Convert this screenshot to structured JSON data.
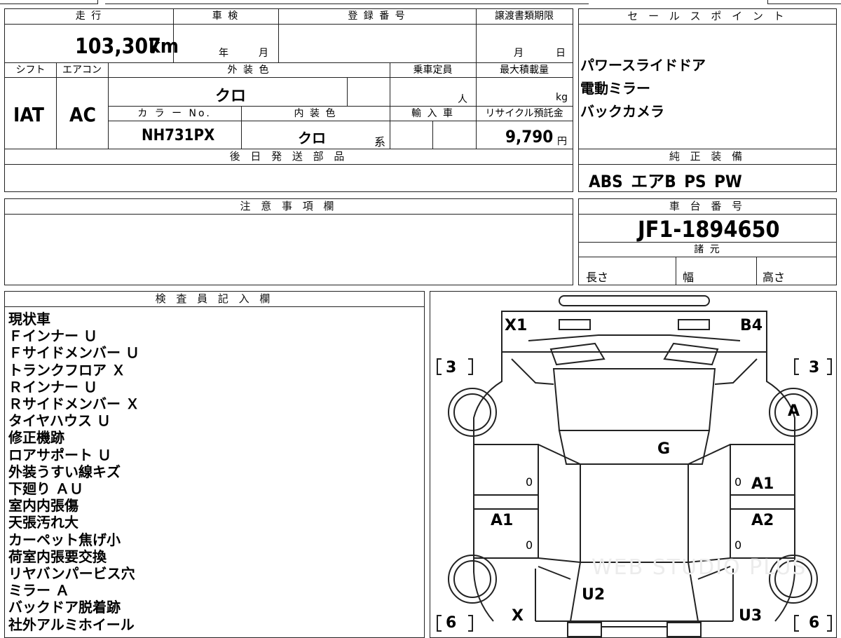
{
  "top_fields": {
    "mileage_header": "走 行",
    "mileage_value": "103,307",
    "mileage_unit": "km",
    "shaken_header": "車 検",
    "shaken_year_unit": "年",
    "shaken_month_unit": "月",
    "reg_number_header": "登 録 番 号",
    "transfer_docs_header": "譲渡書類期限",
    "transfer_month_unit": "月",
    "transfer_day_unit": "日"
  },
  "second_row": {
    "shift_header": "シフト",
    "shift_value": "IAT",
    "ac_header": "エアコン",
    "ac_value": "AC",
    "exterior_color_header": "外 装 色",
    "exterior_color_value": "クロ",
    "capacity_header": "乗車定員",
    "capacity_unit": "人",
    "max_load_header": "最大積載量",
    "max_load_unit": "kg",
    "color_no_header": "カ ラ ー No.",
    "color_no_value": "NH731PX",
    "interior_color_header": "内 装 色",
    "interior_color_value": "クロ",
    "interior_color_suffix": "系",
    "import_header": "輸 入 車",
    "recycle_header": "リサイクル預託金",
    "recycle_value": "9,790",
    "recycle_unit": "円"
  },
  "later_parts": {
    "header": "後 日 発 送 部 品"
  },
  "notes": {
    "header": "注 意 事 項 欄"
  },
  "sales_points": {
    "header": "セ ー ル ス ポ イ ン ト",
    "items": [
      "パワースライドドア",
      "電動ミラー",
      "バックカメラ"
    ]
  },
  "standard_equipment": {
    "header": "純 正 装 備",
    "value": "ABS エアB PS PW"
  },
  "chassis": {
    "header": "車 台 番 号",
    "value": "JF1-1894650"
  },
  "specs": {
    "header": "諸 元",
    "length_label": "長さ",
    "width_label": "幅",
    "height_label": "高さ"
  },
  "inspector": {
    "header": "検 査 員 記 入 欄",
    "lines": [
      "現状車",
      "Ｆインナー Ｕ",
      "Ｆサイドメンバー Ｕ",
      "トランクフロア Ｘ",
      "Ｒインナー Ｕ",
      "Ｒサイドメンバー Ｘ",
      "タイヤハウス Ｕ",
      "修正機跡",
      "ロアサポート Ｕ",
      "外装うすい線キズ",
      "下廻り ＡＵ",
      "室内内張傷",
      "天張汚れ大",
      "カーペット焦げ小",
      "荷室内張要交換",
      "リヤバンパービス穴",
      "ミラー Ａ",
      "バックドア脱着跡",
      "社外アルミホイール"
    ]
  },
  "diagram": {
    "front_left_mark": "X1",
    "front_right_mark": "B4",
    "tire_fl": "3",
    "tire_fr": "3",
    "tire_rl": "6",
    "tire_rr": "6",
    "right_front_wheel_mark": "A",
    "windshield_mark": "G",
    "right_front_door_mark": "A1",
    "left_rear_door_mark": "A1",
    "right_rear_door_mark": "A2",
    "rear_floor_mark": "U2",
    "left_rear_mark": "X",
    "right_rear_mark": "U3",
    "zero_marks": [
      "0",
      "0",
      "0",
      "0"
    ],
    "watermark": "WEB STUDIO PLUS"
  }
}
